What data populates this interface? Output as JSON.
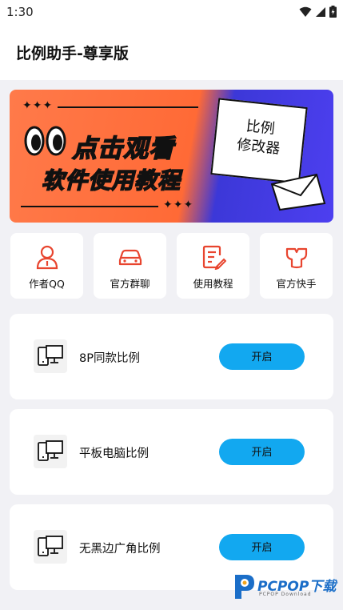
{
  "status_bar": {
    "time": "1:30"
  },
  "app_bar": {
    "title": "比例助手-尊享版"
  },
  "banner": {
    "stars": "✦✦✦",
    "line1": "点击观看",
    "line2": "软件使用教程",
    "note_line1": "比例",
    "note_line2": "修改器"
  },
  "quick_links": [
    {
      "label": "作者QQ",
      "icon": "person-icon"
    },
    {
      "label": "官方群聊",
      "icon": "car-icon"
    },
    {
      "label": "使用教程",
      "icon": "document-edit-icon"
    },
    {
      "label": "官方快手",
      "icon": "kuaishou-icon"
    }
  ],
  "options": [
    {
      "label": "8P同款比例",
      "button": "开启",
      "icon": "devices-icon"
    },
    {
      "label": "平板电脑比例",
      "button": "开启",
      "icon": "devices-icon"
    },
    {
      "label": "无黑边广角比例",
      "button": "开启",
      "icon": "devices-icon"
    }
  ],
  "watermark": {
    "text": "PCPOP下载",
    "sub": "PCPOP Download"
  },
  "colors": {
    "accent": "#12a8f0",
    "icon_red": "#e8452f",
    "banner_orange": "#ff6a36",
    "banner_blue": "#4d3ff0"
  }
}
